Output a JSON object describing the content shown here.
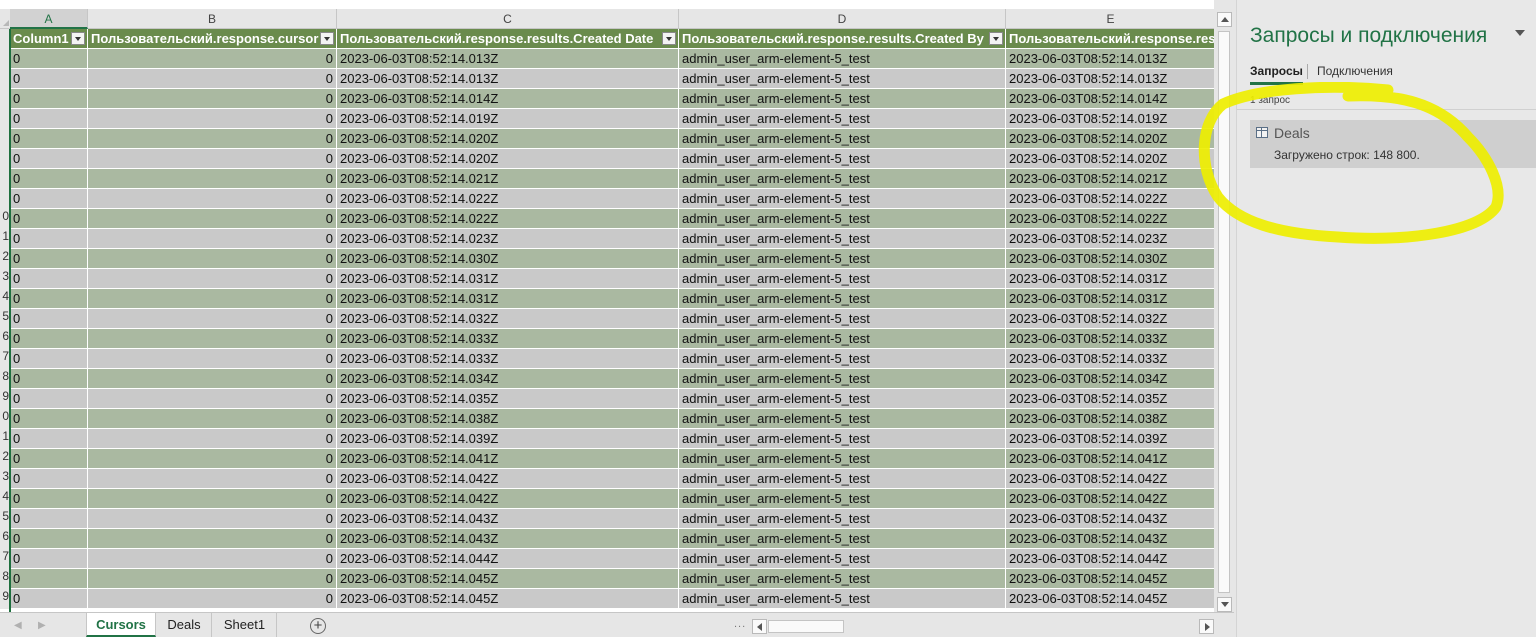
{
  "column_letters": [
    "A",
    "B",
    "C",
    "D",
    "E"
  ],
  "selected_column": "A",
  "table_headers": [
    "Column1",
    "Пользовательский.response.cursor",
    "Пользовательский.response.results.Created Date",
    "Пользовательский.response.results.Created By",
    "Пользовательский.response.results.Modified Date"
  ],
  "row_numbers": [
    "",
    "",
    "",
    "",
    "",
    "",
    "",
    "",
    "0",
    "1",
    "2",
    "3",
    "4",
    "5",
    "6",
    "7",
    "8",
    "9",
    "0",
    "1",
    "2",
    "3",
    "4",
    "5",
    "6",
    "7",
    "8",
    "9"
  ],
  "rows": [
    [
      "0",
      "0",
      "2023-06-03T08:52:14.013Z",
      "admin_user_arm-element-5_test",
      "2023-06-03T08:52:14.013Z"
    ],
    [
      "0",
      "0",
      "2023-06-03T08:52:14.013Z",
      "admin_user_arm-element-5_test",
      "2023-06-03T08:52:14.013Z"
    ],
    [
      "0",
      "0",
      "2023-06-03T08:52:14.014Z",
      "admin_user_arm-element-5_test",
      "2023-06-03T08:52:14.014Z"
    ],
    [
      "0",
      "0",
      "2023-06-03T08:52:14.019Z",
      "admin_user_arm-element-5_test",
      "2023-06-03T08:52:14.019Z"
    ],
    [
      "0",
      "0",
      "2023-06-03T08:52:14.020Z",
      "admin_user_arm-element-5_test",
      "2023-06-03T08:52:14.020Z"
    ],
    [
      "0",
      "0",
      "2023-06-03T08:52:14.020Z",
      "admin_user_arm-element-5_test",
      "2023-06-03T08:52:14.020Z"
    ],
    [
      "0",
      "0",
      "2023-06-03T08:52:14.021Z",
      "admin_user_arm-element-5_test",
      "2023-06-03T08:52:14.021Z"
    ],
    [
      "0",
      "0",
      "2023-06-03T08:52:14.022Z",
      "admin_user_arm-element-5_test",
      "2023-06-03T08:52:14.022Z"
    ],
    [
      "0",
      "0",
      "2023-06-03T08:52:14.022Z",
      "admin_user_arm-element-5_test",
      "2023-06-03T08:52:14.022Z"
    ],
    [
      "0",
      "0",
      "2023-06-03T08:52:14.023Z",
      "admin_user_arm-element-5_test",
      "2023-06-03T08:52:14.023Z"
    ],
    [
      "0",
      "0",
      "2023-06-03T08:52:14.030Z",
      "admin_user_arm-element-5_test",
      "2023-06-03T08:52:14.030Z"
    ],
    [
      "0",
      "0",
      "2023-06-03T08:52:14.031Z",
      "admin_user_arm-element-5_test",
      "2023-06-03T08:52:14.031Z"
    ],
    [
      "0",
      "0",
      "2023-06-03T08:52:14.031Z",
      "admin_user_arm-element-5_test",
      "2023-06-03T08:52:14.031Z"
    ],
    [
      "0",
      "0",
      "2023-06-03T08:52:14.032Z",
      "admin_user_arm-element-5_test",
      "2023-06-03T08:52:14.032Z"
    ],
    [
      "0",
      "0",
      "2023-06-03T08:52:14.033Z",
      "admin_user_arm-element-5_test",
      "2023-06-03T08:52:14.033Z"
    ],
    [
      "0",
      "0",
      "2023-06-03T08:52:14.033Z",
      "admin_user_arm-element-5_test",
      "2023-06-03T08:52:14.033Z"
    ],
    [
      "0",
      "0",
      "2023-06-03T08:52:14.034Z",
      "admin_user_arm-element-5_test",
      "2023-06-03T08:52:14.034Z"
    ],
    [
      "0",
      "0",
      "2023-06-03T08:52:14.035Z",
      "admin_user_arm-element-5_test",
      "2023-06-03T08:52:14.035Z"
    ],
    [
      "0",
      "0",
      "2023-06-03T08:52:14.038Z",
      "admin_user_arm-element-5_test",
      "2023-06-03T08:52:14.038Z"
    ],
    [
      "0",
      "0",
      "2023-06-03T08:52:14.039Z",
      "admin_user_arm-element-5_test",
      "2023-06-03T08:52:14.039Z"
    ],
    [
      "0",
      "0",
      "2023-06-03T08:52:14.041Z",
      "admin_user_arm-element-5_test",
      "2023-06-03T08:52:14.041Z"
    ],
    [
      "0",
      "0",
      "2023-06-03T08:52:14.042Z",
      "admin_user_arm-element-5_test",
      "2023-06-03T08:52:14.042Z"
    ],
    [
      "0",
      "0",
      "2023-06-03T08:52:14.042Z",
      "admin_user_arm-element-5_test",
      "2023-06-03T08:52:14.042Z"
    ],
    [
      "0",
      "0",
      "2023-06-03T08:52:14.043Z",
      "admin_user_arm-element-5_test",
      "2023-06-03T08:52:14.043Z"
    ],
    [
      "0",
      "0",
      "2023-06-03T08:52:14.043Z",
      "admin_user_arm-element-5_test",
      "2023-06-03T08:52:14.043Z"
    ],
    [
      "0",
      "0",
      "2023-06-03T08:52:14.044Z",
      "admin_user_arm-element-5_test",
      "2023-06-03T08:52:14.044Z"
    ],
    [
      "0",
      "0",
      "2023-06-03T08:52:14.045Z",
      "admin_user_arm-element-5_test",
      "2023-06-03T08:52:14.045Z"
    ],
    [
      "0",
      "0",
      "2023-06-03T08:52:14.045Z",
      "admin_user_arm-element-5_test",
      "2023-06-03T08:52:14.045Z"
    ]
  ],
  "sheet_tabs": [
    {
      "label": "Cursors",
      "active": true
    },
    {
      "label": "Deals",
      "active": false
    },
    {
      "label": "Sheet1",
      "active": false
    }
  ],
  "add_sheet_glyph": "+",
  "hscroll_dots": "...",
  "pane": {
    "title": "Запросы и подключения",
    "tabs": [
      "Запросы",
      "Подключения"
    ],
    "query_count": "1 запрос",
    "query": {
      "name": "Deals",
      "status": "Загружено строк: 148 800."
    }
  },
  "colors": {
    "accent": "#217346",
    "table_header": "#6a8b4d",
    "band_green": "#aab9a1",
    "band_gray": "#c9c9c9",
    "highlight": "#eeee00"
  }
}
